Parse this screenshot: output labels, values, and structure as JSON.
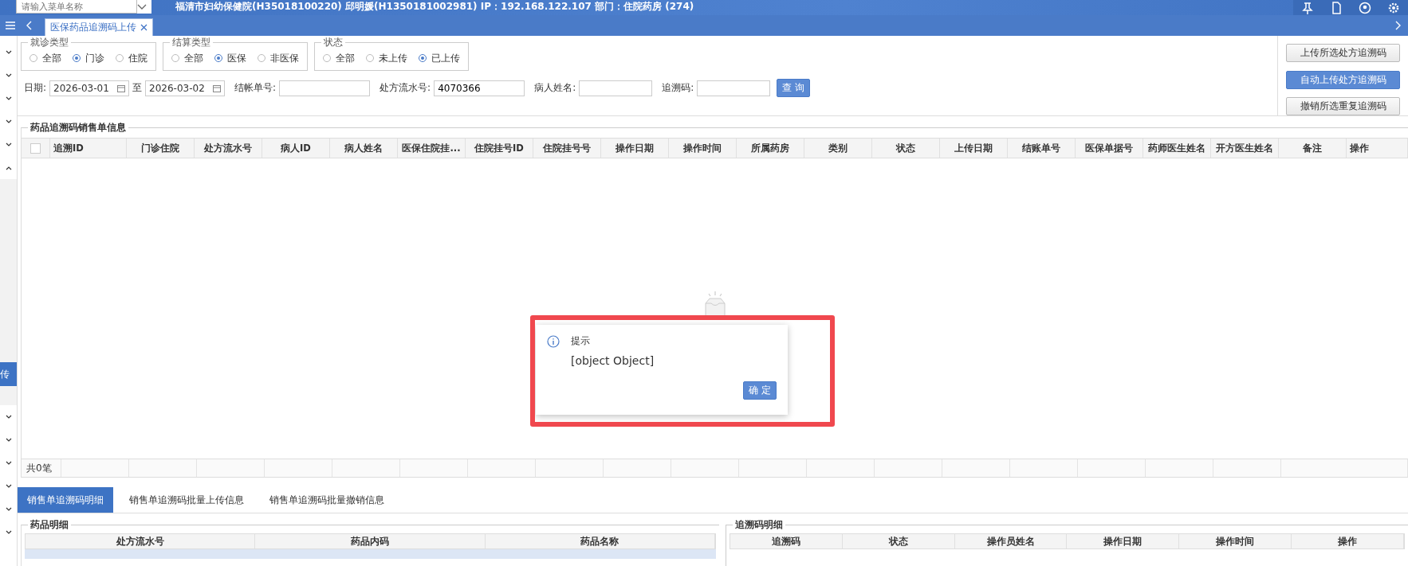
{
  "header": {
    "menu_search": {
      "placeholder": "请输入菜单名称"
    },
    "title": "福清市妇幼保健院(H35018100220) 邱明媛(H1350181002981) IP：192.168.122.107 部门：住院药房 (274)"
  },
  "tab_bar": {
    "tabs": [
      {
        "label": "医保药品追溯码上传",
        "selected": true
      }
    ]
  },
  "sidebar": {
    "items": [
      {
        "kind": "group",
        "expanded": false
      },
      {
        "kind": "group",
        "expanded": false
      },
      {
        "kind": "group",
        "expanded": false
      },
      {
        "kind": "group",
        "expanded": false
      },
      {
        "kind": "group",
        "expanded": false
      },
      {
        "kind": "group",
        "expanded": true
      },
      {
        "kind": "item",
        "label": "传",
        "selected": true
      },
      {
        "kind": "group",
        "expanded": false
      },
      {
        "kind": "group",
        "expanded": false
      },
      {
        "kind": "group",
        "expanded": false
      },
      {
        "kind": "group",
        "expanded": false
      },
      {
        "kind": "group",
        "expanded": false
      },
      {
        "kind": "group",
        "expanded": false
      }
    ]
  },
  "filters": {
    "groups": [
      {
        "legend": "就诊类型",
        "options": [
          {
            "label": "全部",
            "selected": false
          },
          {
            "label": "门诊",
            "selected": true
          },
          {
            "label": "住院",
            "selected": false
          }
        ]
      },
      {
        "legend": "结算类型",
        "options": [
          {
            "label": "全部",
            "selected": false
          },
          {
            "label": "医保",
            "selected": true
          },
          {
            "label": "非医保",
            "selected": false
          }
        ]
      },
      {
        "legend": "状态",
        "options": [
          {
            "label": "全部",
            "selected": false
          },
          {
            "label": "未上传",
            "selected": false
          },
          {
            "label": "已上传",
            "selected": true
          }
        ]
      }
    ],
    "date": {
      "label": "日期:",
      "from": "2026-03-01",
      "separator": "至",
      "to": "2026-03-02"
    },
    "fields": [
      {
        "label": "结帐单号:"
      },
      {
        "label": "处方流水号:",
        "value": "4070366"
      },
      {
        "label": "病人姓名:"
      },
      {
        "label": "追溯码:"
      }
    ],
    "query_button": "查 询"
  },
  "side_buttons": [
    {
      "label": "上传所选处方追溯码",
      "primary": false
    },
    {
      "label": "自动上传处方追溯码",
      "primary": true
    },
    {
      "label": "撤销所选重复追溯码",
      "primary": false
    }
  ],
  "main_table": {
    "title": "药品追溯码销售单信息",
    "select_all": {
      "checked": false
    },
    "columns": [
      "追溯ID",
      "门诊住院",
      "处方流水号",
      "病人ID",
      "病人姓名",
      "医保住院挂...",
      "住院挂号ID",
      "住院挂号号",
      "操作日期",
      "操作时间",
      "所属药房",
      "类别",
      "状态",
      "上传日期",
      "结账单号",
      "医保单据号",
      "药师医生姓名",
      "开方医生姓名",
      "备注",
      "操作"
    ],
    "footer": "共0笔"
  },
  "dialog": {
    "title": "提示",
    "message": "[object Object]",
    "button": "确 定"
  },
  "bottom_tabs": [
    {
      "label": "销售单追溯码明细",
      "selected": true
    },
    {
      "label": "销售单追溯码批量上传信息",
      "selected": false
    },
    {
      "label": "销售单追溯码批量撤销信息",
      "selected": false
    }
  ],
  "drug_detail": {
    "title": "药品明细",
    "columns": [
      "处方流水号",
      "药品内码",
      "药品名称"
    ],
    "rows": [
      {
        "selected": true
      }
    ]
  },
  "trace_detail": {
    "title": "追溯码明细",
    "columns": [
      "追溯码",
      "状态",
      "操作员姓名",
      "操作日期",
      "操作时间",
      "操作"
    ]
  }
}
